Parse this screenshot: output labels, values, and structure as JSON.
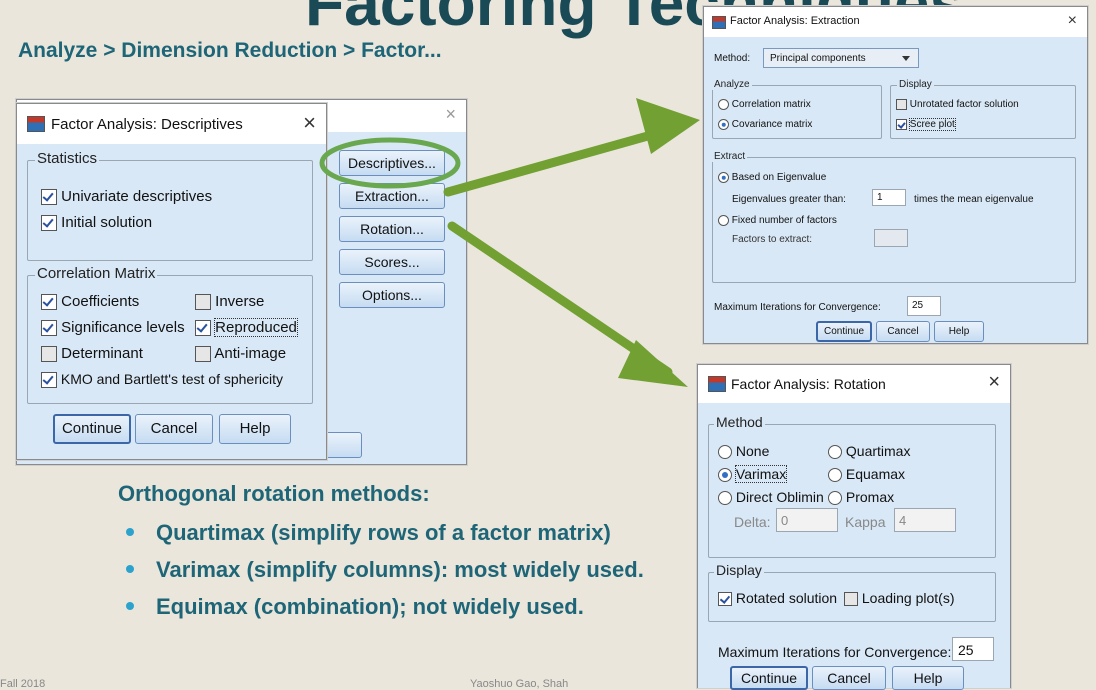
{
  "slide": {
    "title": "Factoring Techniques",
    "menu_path": "Analyze > Dimension Reduction > Factor...",
    "orthogonal_heading": "Orthogonal rotation methods:",
    "bullets": [
      "Quartimax  (simplify rows of a factor matrix)",
      "Varimax  (simplify columns): most widely used.",
      "Equimax  (combination); not widely used."
    ],
    "footer_left": "Fall 2018",
    "footer_mid": "Yaoshuo Gao, Shah"
  },
  "colors": {
    "arrow": "#72a033",
    "highlight_ring": "#6aa84f",
    "dialog_body": "#d9e8f6",
    "text_teal": "#1e6577",
    "bullet": "#2ba3cc"
  },
  "main_dialog": {
    "buttons": [
      "Descriptives...",
      "Extraction...",
      "Rotation...",
      "Scores...",
      "Options..."
    ],
    "close": "×"
  },
  "descriptives": {
    "title": "Factor Analysis: Descriptives",
    "close": "×",
    "statistics_legend": "Statistics",
    "univariate": "Univariate descriptives",
    "initial": "Initial solution",
    "corr_legend": "Correlation Matrix",
    "coefficients": "Coefficients",
    "inverse": "Inverse",
    "significance": "Significance levels",
    "reproduced": "Reproduced",
    "determinant": "Determinant",
    "antiimage": "Anti-image",
    "kmo": "KMO and Bartlett's test of sphericity",
    "continue": "Continue",
    "cancel": "Cancel",
    "help": "Help"
  },
  "extraction": {
    "title": "Factor Analysis: Extraction",
    "close": "×",
    "method_label": "Method:",
    "method_value": "Principal components",
    "analyze_legend": "Analyze",
    "correlation": "Correlation matrix",
    "covariance": "Covariance matrix",
    "display_legend": "Display",
    "unrotated": "Unrotated factor solution",
    "scree": "Scree plot",
    "extract_legend": "Extract",
    "based_eigen": "Based on Eigenvalue",
    "eigen_greater": "Eigenvalues greater than:",
    "eigen_value": "1",
    "times_mean": "times the mean eigenvalue",
    "fixed_number": "Fixed number of factors",
    "factors_to_extract": "Factors to extract:",
    "factors_value": "",
    "max_iter_label": "Maximum Iterations for Convergence:",
    "max_iter_value": "25",
    "continue": "Continue",
    "cancel": "Cancel",
    "help": "Help"
  },
  "rotation": {
    "title": "Factor Analysis: Rotation",
    "close": "×",
    "method_legend": "Method",
    "none": "None",
    "quartimax": "Quartimax",
    "varimax": "Varimax",
    "equamax": "Equamax",
    "direct_oblimin": "Direct Oblimin",
    "promax": "Promax",
    "delta_label": "Delta:",
    "delta_value": "0",
    "kappa_label": "Kappa",
    "kappa_value": "4",
    "display_legend": "Display",
    "rotated_solution": "Rotated solution",
    "loading_plots": "Loading plot(s)",
    "max_iter_label": "Maximum Iterations for Convergence:",
    "max_iter_value": "25",
    "continue": "Continue",
    "cancel": "Cancel",
    "help": "Help"
  }
}
